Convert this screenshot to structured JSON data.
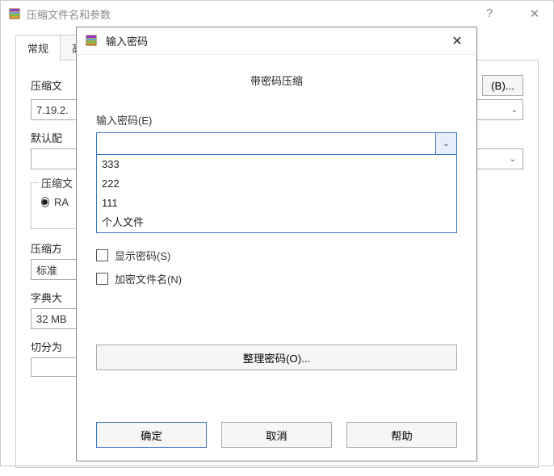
{
  "parent": {
    "title": "压缩文件名和参数",
    "help_symbol": "?",
    "close_symbol": "✕",
    "tabs": {
      "general": "常规",
      "high_partial": "高"
    },
    "labels": {
      "archive_name_partial": "压缩文",
      "default_config_partial": "默认配",
      "format_group_partial": "压缩文",
      "method_partial": "压缩方",
      "dict_size_partial": "字典大",
      "split_partial": "切分为"
    },
    "values": {
      "filename_partial": "7.19.2.",
      "ra_radio_partial": "RA",
      "method_value": "标准",
      "dict_value": "32 MB"
    },
    "buttons": {
      "browse": "(B)..."
    }
  },
  "modal": {
    "title": "输入密码",
    "close_symbol": "✕",
    "heading": "带密码压缩",
    "password_label": "输入密码(E)",
    "password_value": "",
    "dropdown_indicator": "⌄",
    "history": [
      "333",
      "222",
      "111",
      "个人文件"
    ],
    "checkboxes": {
      "show_password": "显示密码(S)",
      "encrypt_names": "加密文件名(N)"
    },
    "organize_button": "整理密码(O)...",
    "buttons": {
      "ok": "确定",
      "cancel": "取消",
      "help": "帮助"
    }
  }
}
